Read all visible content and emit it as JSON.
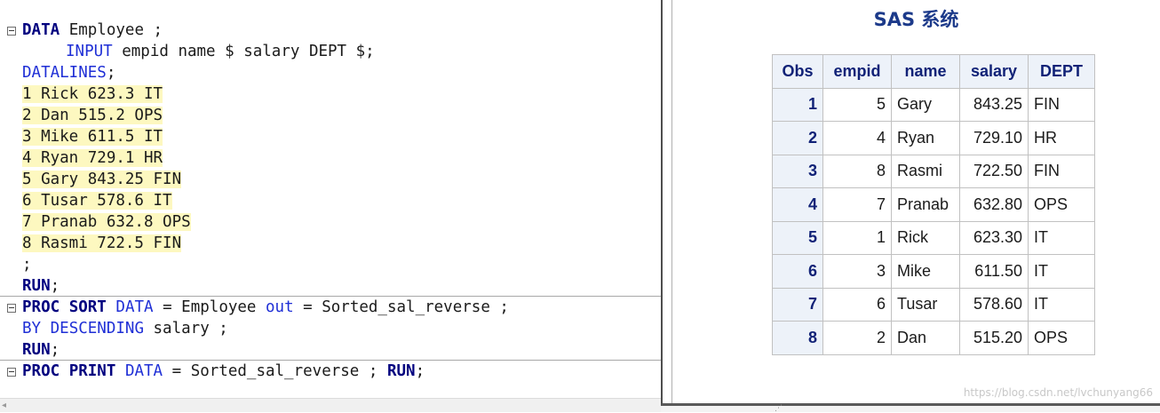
{
  "editor": {
    "data_step": {
      "kw_data": "DATA",
      "dataset": " Employee ;",
      "kw_input": "INPUT",
      "input_vars": " empid name $ salary DEPT $;",
      "kw_datalines": "DATALINES",
      "datalines_semicolon": ";",
      "datalines": [
        "1 Rick 623.3 IT",
        "2 Dan 515.2 OPS",
        "3 Mike 611.5 IT",
        "4 Ryan 729.1 HR",
        "5 Gary 843.25 FIN",
        "6 Tusar 578.6 IT",
        "7 Pranab 632.8 OPS",
        "8 Rasmi 722.5 FIN"
      ],
      "end_semicolon": ";",
      "kw_run": "RUN",
      "run_semicolon": ";"
    },
    "sort_step": {
      "kw_proc": "PROC",
      "kw_sort": "SORT",
      "kw_data": "DATA",
      "eq1": " = Employee ",
      "kw_out": "out",
      "eq2": " = Sorted_sal_reverse ;",
      "kw_by": "BY",
      "kw_descending": "DESCENDING",
      "by_var": " salary ;",
      "kw_run": "RUN",
      "run_semicolon": ";"
    },
    "print_step": {
      "kw_proc": "PROC",
      "kw_print": "PRINT",
      "kw_data": "DATA",
      "rest": " = Sorted_sal_reverse ; ",
      "kw_run": "RUN",
      "run_semicolon": ";"
    }
  },
  "results": {
    "title": "SAS 系统",
    "columns": [
      "Obs",
      "empid",
      "name",
      "salary",
      "DEPT"
    ],
    "rows": [
      [
        "1",
        "5",
        "Gary",
        "843.25",
        "FIN"
      ],
      [
        "2",
        "4",
        "Ryan",
        "729.10",
        "HR"
      ],
      [
        "3",
        "8",
        "Rasmi",
        "722.50",
        "FIN"
      ],
      [
        "4",
        "7",
        "Pranab",
        "632.80",
        "OPS"
      ],
      [
        "5",
        "1",
        "Rick",
        "623.30",
        "IT"
      ],
      [
        "6",
        "3",
        "Mike",
        "611.50",
        "IT"
      ],
      [
        "7",
        "6",
        "Tusar",
        "578.60",
        "IT"
      ],
      [
        "8",
        "2",
        "Dan",
        "515.20",
        "OPS"
      ]
    ]
  },
  "watermark": "https://blog.csdn.net/lvchunyang66",
  "colors": {
    "keyword_bold": "#00007f",
    "keyword": "#1f2fd6",
    "datalines_highlight": "#fdf8c0",
    "table_header_bg": "#edf2f9",
    "table_header_text": "#112277",
    "title": "#1c3a8a"
  }
}
